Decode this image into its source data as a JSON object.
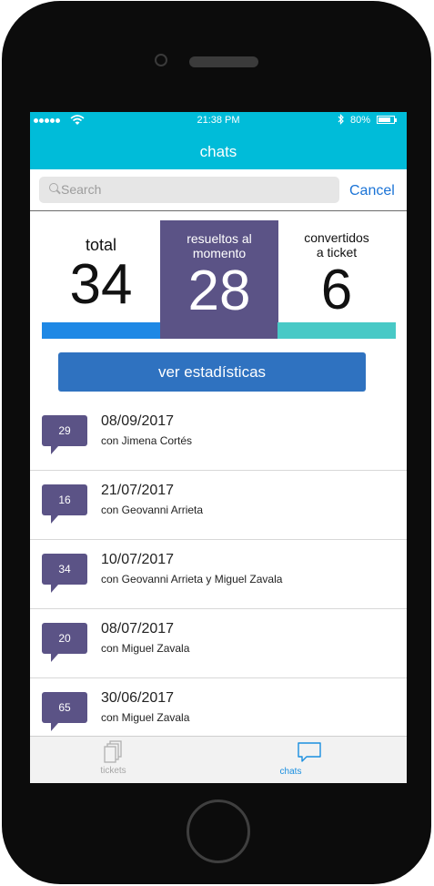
{
  "status_bar": {
    "time": "21:38 PM",
    "battery_percent": "80%",
    "battery_level": 0.8,
    "bluetooth_icon": "bluetooth-icon",
    "wifi_icon": "wifi-icon"
  },
  "header": {
    "title": "chats"
  },
  "search": {
    "placeholder": "Search",
    "cancel_label": "Cancel"
  },
  "stats": {
    "total": {
      "label": "total",
      "value": "34",
      "color": "#1e88e5"
    },
    "resolved": {
      "label_line1": "resueltos al",
      "label_line2": "momento",
      "value": "28",
      "color": "#5b5386"
    },
    "converted": {
      "label_line1": "convertidos",
      "label_line2": "a ticket",
      "value": "6",
      "color": "#48c9c6"
    }
  },
  "stats_button": {
    "label": "ver estadísticas"
  },
  "chats": [
    {
      "count": "29",
      "date": "08/09/2017",
      "with": "con  Jimena Cortés"
    },
    {
      "count": "16",
      "date": "21/07/2017",
      "with": "con Geovanni Arrieta"
    },
    {
      "count": "34",
      "date": "10/07/2017",
      "with": "con Geovanni Arrieta y Miguel Zavala"
    },
    {
      "count": "20",
      "date": "08/07/2017",
      "with": "con Miguel Zavala"
    },
    {
      "count": "65",
      "date": "30/06/2017",
      "with": "con Miguel Zavala"
    }
  ],
  "tabbar": {
    "tickets_label": "tickets",
    "chats_label": "chats",
    "active_tab": "chats",
    "accent": "#1a8fe0"
  }
}
